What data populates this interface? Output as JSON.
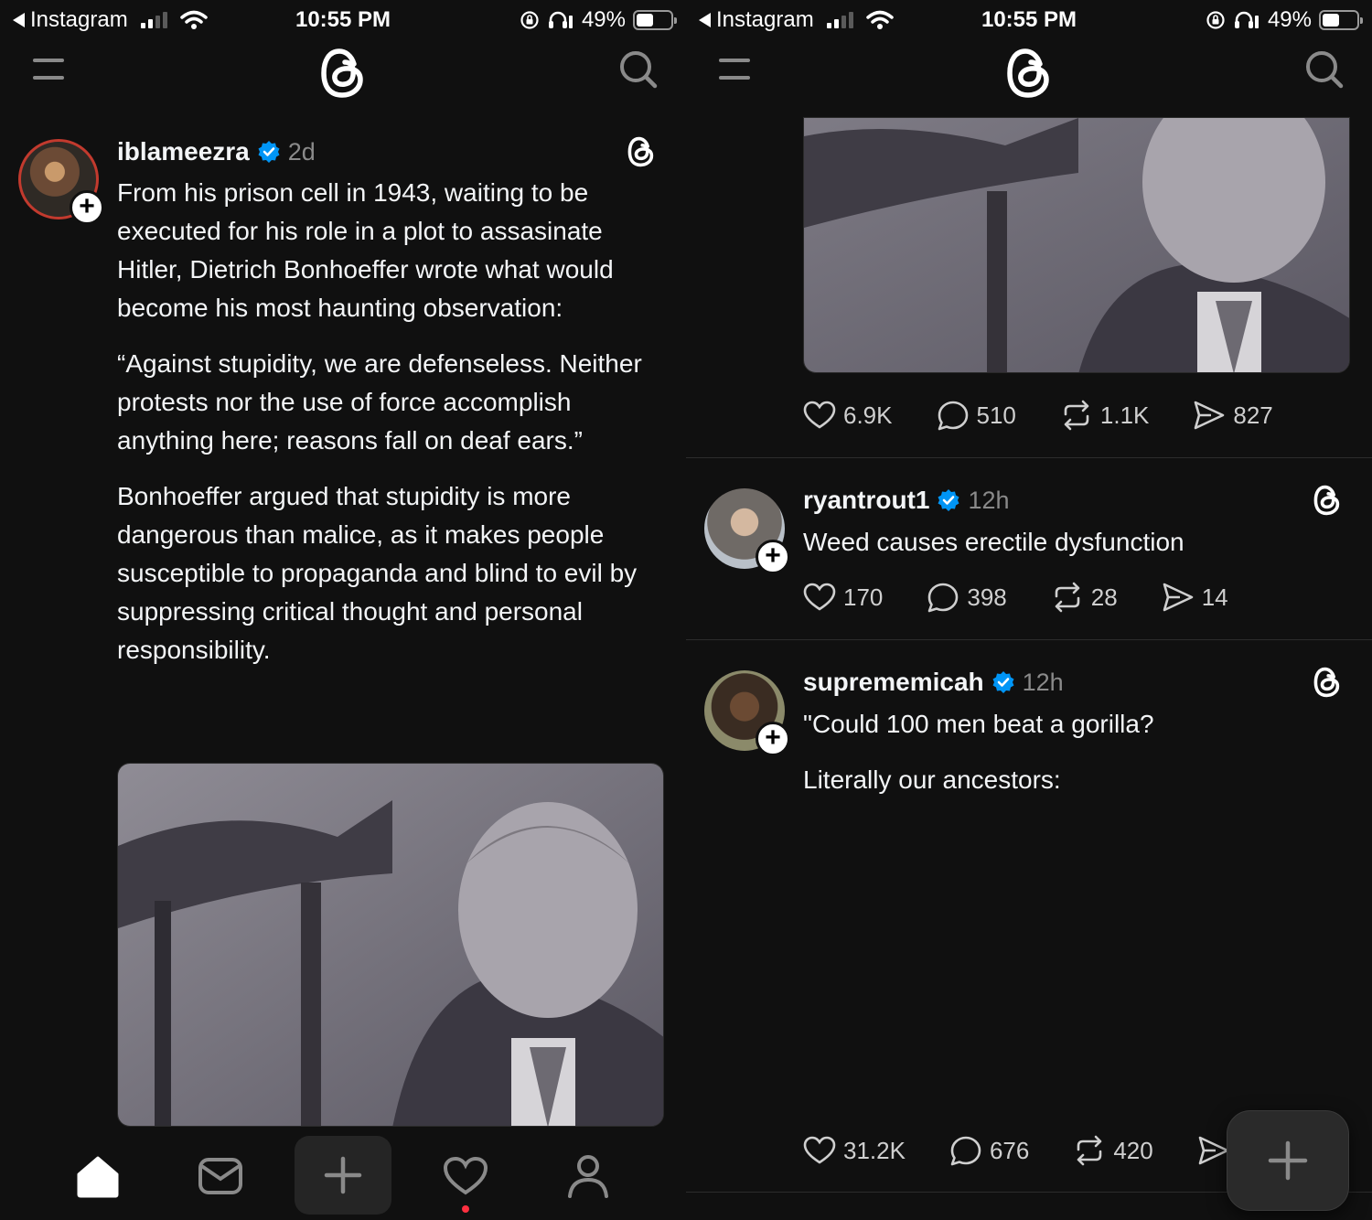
{
  "status_bar": {
    "back_app": "Instagram",
    "time": "10:55 PM",
    "battery": "49%"
  },
  "left_post": {
    "username": "iblameezra",
    "ago": "2d",
    "paragraphs": [
      "From his prison cell in 1943, waiting to be executed for his role in a plot to assasinate Hitler, Dietrich Bonhoeffer wrote what would become his most haunting observation:",
      "“Against stupidity, we are defenseless. Neither protests nor the use of force accomplish anything here; reasons fall on deaf ears.”",
      "Bonhoeffer argued that stupidity is more dangerous than malice, as it makes people susceptible to propaganda and blind to evil by suppressing critical thought and personal responsibility."
    ],
    "stats": {
      "likes": "6.9K",
      "replies": "510",
      "reposts": "1.1K",
      "shares": "827"
    }
  },
  "posts": [
    {
      "username": "ryantrout1",
      "ago": "12h",
      "text": "Weed causes erectile dysfunction",
      "stats": {
        "likes": "170",
        "replies": "398",
        "reposts": "28",
        "shares": "14"
      }
    },
    {
      "username": "suprememicah",
      "ago": "12h",
      "text_1": "\"Could 100 men beat a gorilla?",
      "text_2": "Literally our ancestors:",
      "stats": {
        "likes": "31.2K",
        "replies": "676",
        "reposts": "420"
      }
    }
  ],
  "colors": {
    "background": "#101010",
    "verified": "#0095f6",
    "notification_dot": "#ff3040"
  },
  "icons": [
    "menu-icon",
    "threads-logo-icon",
    "search-icon",
    "verified-badge-icon",
    "heart-icon",
    "comment-icon",
    "repost-icon",
    "share-icon",
    "home-icon",
    "inbox-icon",
    "plus-icon",
    "activity-heart-icon",
    "profile-icon"
  ]
}
